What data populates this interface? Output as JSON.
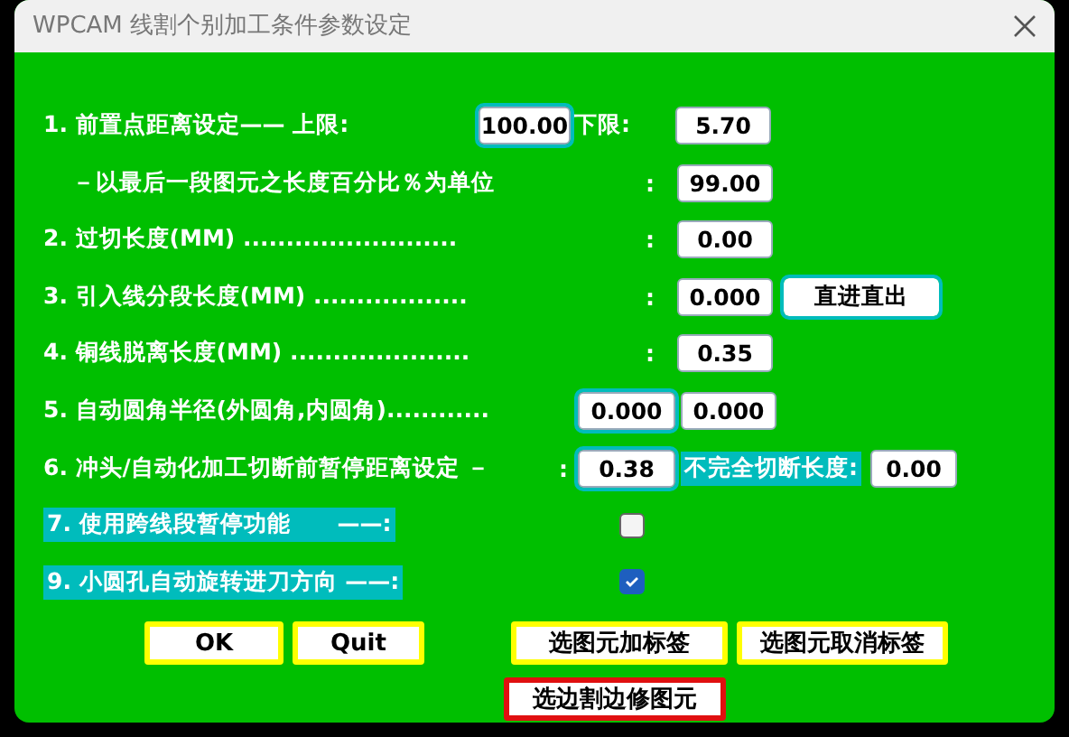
{
  "window": {
    "title": "WPCAM 线割个别加工条件参数设定"
  },
  "rows": [
    {
      "kind": "range",
      "label": "1.  前置点距离设定——  上限:",
      "value": "100.00",
      "label_2": "下限:",
      "value_2": "5.70"
    },
    {
      "kind": "field",
      "label": "－以最后一段图元之长度百分比％为单位",
      "colon": ":",
      "value": "99.00"
    },
    {
      "kind": "field",
      "label": "2. 过切长度(MM)  .........................",
      "colon": ":",
      "value": "0.00"
    },
    {
      "kind": "field_button",
      "label": "3. 引入线分段长度(MM)  ..................",
      "colon": ":",
      "value": "0.000",
      "button": "直进直出"
    },
    {
      "kind": "field",
      "label": "4. 铜线脱离长度(MM)  .....................",
      "colon": ":",
      "value": "0.35"
    },
    {
      "kind": "pair",
      "label": "5. 自动圆角半径(外圆角,内圆角)............",
      "value": "0.000",
      "value_2": "0.000"
    },
    {
      "kind": "cut",
      "label": "6. 冲头/自动化加工切断前暂停距离设定 －",
      "colon": ":",
      "value": "0.38",
      "label_2": "不完全切断长度:",
      "value_2": "0.00"
    },
    {
      "kind": "check",
      "label": "7. 使用跨线段暂停功能　　——:",
      "checked": false
    },
    {
      "kind": "check",
      "label": "9. 小圆孔自动旋转进刀方向 ——:",
      "checked": true
    }
  ],
  "buttons": [
    {
      "label": "OK",
      "focused": false
    },
    {
      "label": "Quit",
      "focused": false
    },
    {
      "label": "选图元加标签",
      "focused": false
    },
    {
      "label": "选图元取消标签",
      "focused": false
    },
    {
      "label": "选边割边修图元",
      "focused": true
    }
  ]
}
